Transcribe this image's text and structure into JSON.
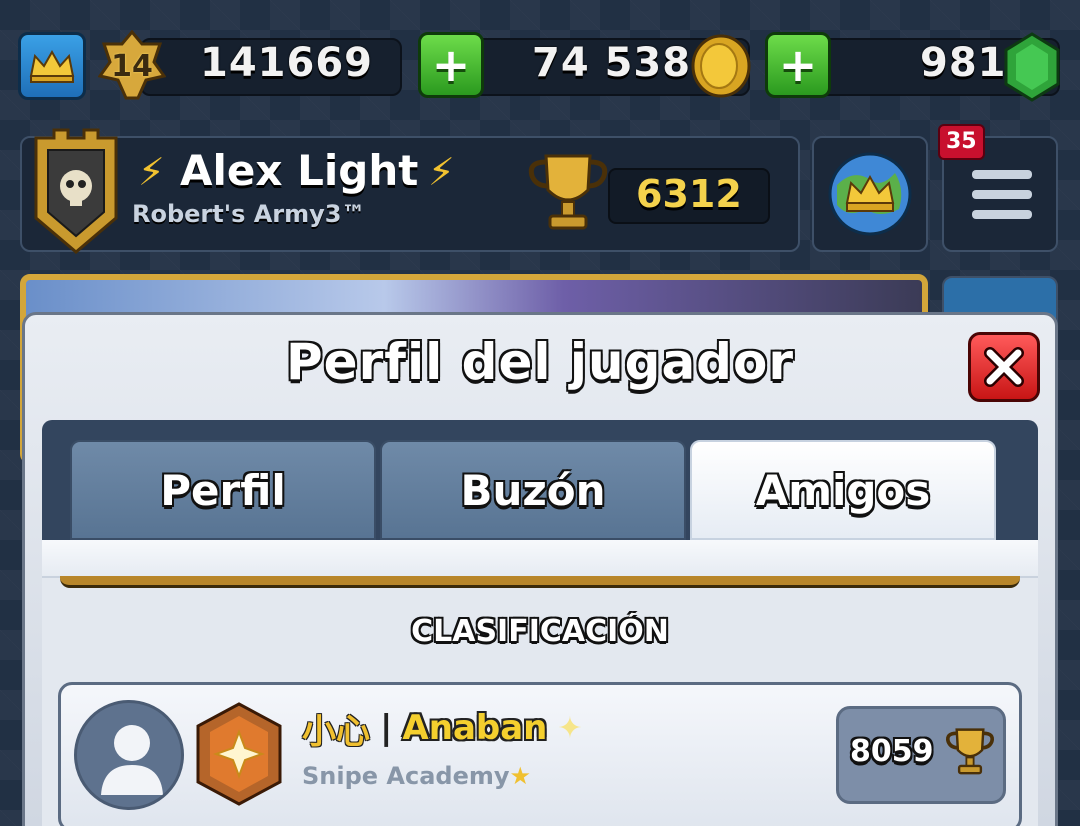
{
  "resources": {
    "level": "14",
    "experience": "141669",
    "gold": "74 538",
    "gems": "981"
  },
  "player": {
    "name": "Alex Light",
    "clan": "Robert's Army3™",
    "trophies": "6312",
    "notifications": "35"
  },
  "modal": {
    "title": "Perfil del jugador",
    "tabs": [
      {
        "label": "Perfil",
        "active": false
      },
      {
        "label": "Buzón",
        "active": false
      },
      {
        "label": "Amigos",
        "active": true
      }
    ],
    "section_title": "CLASIFICACIÓN",
    "friends": [
      {
        "prefix": "小心",
        "separator": "|",
        "name": "Anaban",
        "clan": "Snipe Academy",
        "trophies": "8059"
      }
    ]
  },
  "colors": {
    "gold_text": "#f4d24c",
    "accent_green": "#2b9a1f",
    "close_red": "#c81515"
  }
}
